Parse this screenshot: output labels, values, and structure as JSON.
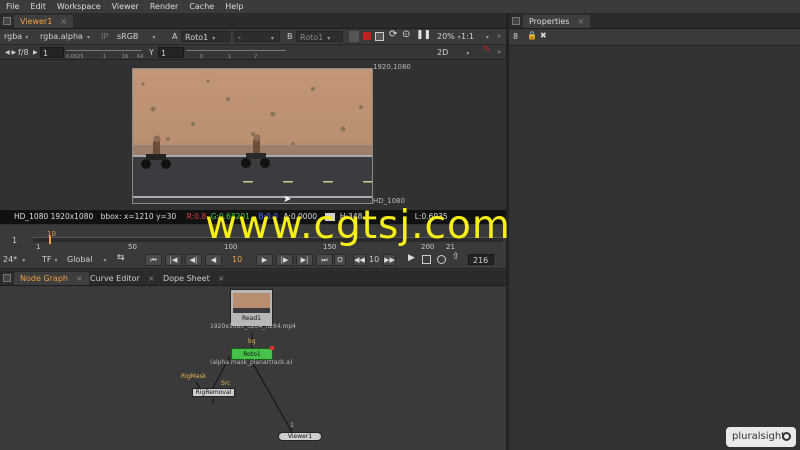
{
  "menu": [
    "File",
    "Edit",
    "Workspace",
    "Viewer",
    "Render",
    "Cache",
    "Help"
  ],
  "viewer_tab": {
    "label": "Viewer1",
    "close": "×"
  },
  "toolbar1": {
    "channels": "rgba",
    "alpha": "rgba.alpha",
    "ip": "IP",
    "colorspace": "sRGB",
    "a_label": "A",
    "a_input": "Roto1",
    "a_op": "-",
    "b_label": "B",
    "b_input": "Roto1",
    "zoom": "20%",
    "ratio": "1:1"
  },
  "toolbar2": {
    "fstop": "f/8",
    "gain": "1",
    "y_label": "Y",
    "gamma": "1",
    "view_mode": "2D",
    "gain_ticks": [
      "0.0625",
      "1",
      "16",
      "64"
    ],
    "gamma_ticks": [
      "0",
      "1",
      "2"
    ]
  },
  "viewer": {
    "format_top": "1920,1080",
    "format_bottom": "HD_1080"
  },
  "info_bar": {
    "format": "HD_1080 1920x1080",
    "bbox": "bbox: x=1210 y=30",
    "r": "R:0.8",
    "g": "G:0.68201",
    "b": "B:0.0",
    "a": "A:0.0000",
    "h": "H:348",
    "l": "L:0.6935"
  },
  "timeline": {
    "current_frame": "10",
    "start": "1",
    "ticks": [
      "1",
      "50",
      "100",
      "150",
      "200",
      "21"
    ],
    "indicator": "10"
  },
  "transport": {
    "fps": "24*",
    "tf": "TF",
    "scope": "Global",
    "frame": "10",
    "step": "10",
    "end_frame": "216"
  },
  "node_tabs": [
    {
      "label": "Node Graph",
      "active": true
    },
    {
      "label": "Curve Editor",
      "active": false
    },
    {
      "label": "Dope Sheet",
      "active": false
    }
  ],
  "nodes": {
    "read": {
      "label": "Read1",
      "sub": "1920x1080_0264_h264.mp4"
    },
    "roto": {
      "label": "Roto1",
      "sub": "(alpha mask_planartrack.a)",
      "input": "bg"
    },
    "rigmask_label": "RigMask",
    "src_label": "Src",
    "rigremoval": {
      "label": "RigRemoval"
    },
    "viewer": {
      "label": "Viewer1",
      "input": "1"
    }
  },
  "properties": {
    "tab": "Properties",
    "close": "×",
    "count": "8"
  },
  "watermark": "www.cgtsj.com",
  "badge": "pluralsight",
  "colors": {
    "accent": "#f0a040",
    "watermark": "#f7ef18",
    "roto_node": "#46c24a",
    "read_node": "#b7b7b7",
    "viewer_node": "#cfcfcf"
  }
}
